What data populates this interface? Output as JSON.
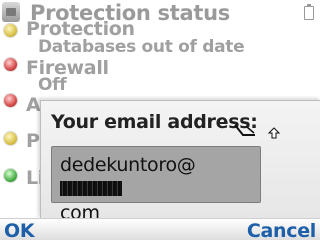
{
  "header": {
    "title": "Protection status",
    "app_icon": "protection-app-icon",
    "battery_icon": "battery-icon"
  },
  "list": {
    "items": [
      {
        "title": "Protection",
        "subtitle": "Databases out of date",
        "dot_color": "#d9c24a"
      },
      {
        "title": "Firewall",
        "subtitle": "Off",
        "dot_color": "#d64a4a"
      },
      {
        "title": "A",
        "subtitle": "",
        "dot_color": "#d64a4a"
      },
      {
        "title": "P",
        "subtitle": "",
        "dot_color": "#d9c24a"
      },
      {
        "title": "Li",
        "subtitle": "",
        "dot_color": "#4ab04a"
      }
    ]
  },
  "dialog": {
    "label": "Your email address:",
    "input_value_visible": "dedekuntoro@",
    "input_value_line2": "com",
    "redacted_segment": "redacted",
    "icons": [
      "pen-input-icon",
      "shift-arrow-icon"
    ]
  },
  "softkeys": {
    "left": "OK",
    "right": "Cancel",
    "color": "#1d5fa8"
  }
}
